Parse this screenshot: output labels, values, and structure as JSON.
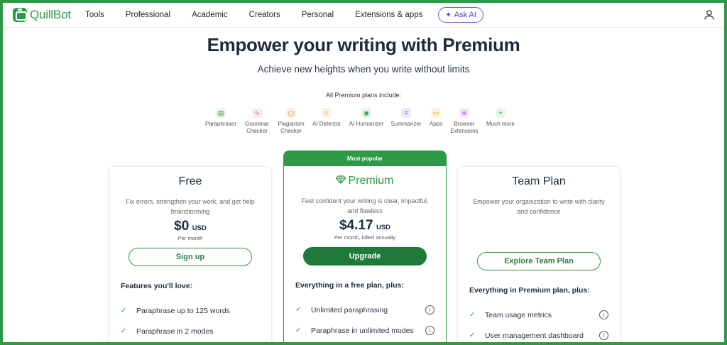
{
  "brand": {
    "name": "QuillBot",
    "color": "#2e9a48"
  },
  "nav": {
    "items": [
      "Tools",
      "Professional",
      "Academic",
      "Creators",
      "Personal",
      "Extensions & apps"
    ],
    "ask_ai": "Ask AI"
  },
  "hero": {
    "title": "Empower your writing with Premium",
    "subtitle": "Achieve new heights when you write without limits",
    "includes_label": "All Premium plans include:"
  },
  "features": [
    {
      "label": "Paraphraser",
      "icon": "paraphraser-icon",
      "color": "#2e9a48"
    },
    {
      "label": "Grammar Checker",
      "icon": "grammar-checker-icon",
      "color": "#d9534f"
    },
    {
      "label": "Plagiarism Checker",
      "icon": "plagiarism-checker-icon",
      "color": "#e07b39"
    },
    {
      "label": "AI Detector",
      "icon": "ai-detector-icon",
      "color": "#e59a2e"
    },
    {
      "label": "AI Humanizer",
      "icon": "ai-humanizer-icon",
      "color": "#2e9a48"
    },
    {
      "label": "Summarizer",
      "icon": "summarizer-icon",
      "color": "#7b5cd6"
    },
    {
      "label": "Apps",
      "icon": "apps-icon",
      "color": "#e5a82e"
    },
    {
      "label": "Browser Extensions",
      "icon": "browser-extensions-icon",
      "color": "#b35cd6"
    },
    {
      "label": "Much more",
      "icon": "plus-icon",
      "color": "#2e9a48"
    }
  ],
  "plans": {
    "free": {
      "title": "Free",
      "description": "Fix errors, strengthen your work, and get help brainstorming",
      "price": "$0",
      "currency": "USD",
      "price_note": "Per month",
      "button": "Sign up",
      "section_label": "Features you'll love:",
      "features": [
        "Paraphrase up to 125 words",
        "Paraphrase in 2 modes"
      ]
    },
    "premium": {
      "badge": "Most popular",
      "title": "Premium",
      "description": "Feel confident your writing is clear, impactful, and flawless",
      "price": "$4.17",
      "currency": "USD",
      "price_note": "Per month, billed annually",
      "button": "Upgrade",
      "section_label": "Everything in a free plan, plus:",
      "features": [
        "Unlimited paraphrasing",
        "Paraphrase in unlimited modes"
      ]
    },
    "team": {
      "title": "Team Plan",
      "description": "Empower your organization to write with clarity and confidence",
      "button": "Explore Team Plan",
      "section_label": "Everything in Premium plan, plus:",
      "features": [
        "Team usage metrics",
        "User management dashboard"
      ]
    }
  }
}
